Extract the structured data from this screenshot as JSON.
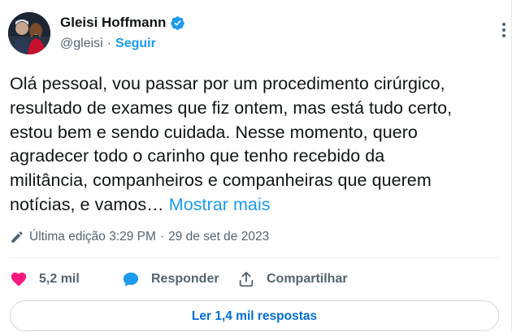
{
  "tweet": {
    "author": {
      "display_name": "Gleisi Hoffmann",
      "handle": "@gleisi",
      "separator": "·",
      "follow_label": "Seguir",
      "verified": true
    },
    "text_lines": [
      "Olá pessoal, vou passar por um procedimento cirúrgico,",
      "resultado de exames que fiz ontem, mas está tudo certo,",
      "estou bem e sendo cuidada. Nesse momento, quero",
      "agradecer todo o carinho que tenho recebido da",
      "militância, companheiros e companheiras que querem",
      "notícias, e vamos…"
    ],
    "show_more_label": "Mostrar mais",
    "edit_info": {
      "label": "Última edição 3:29 PM",
      "separator": "·",
      "date": "29 de set de 2023"
    },
    "actions": {
      "like_count": "5,2 mil",
      "reply_label": "Responder",
      "share_label": "Compartilhar"
    },
    "read_replies_label": "Ler 1,4 mil respostas"
  },
  "colors": {
    "accent": "#1d9bf0",
    "like": "#f91880",
    "secondary_text": "#536471",
    "link_button_text": "#006fd6"
  },
  "icons": {
    "verified": "verified-badge-icon",
    "more": "more-options-icon",
    "edit": "pencil-icon",
    "like": "heart-icon",
    "reply": "speech-bubble-icon",
    "share": "share-upload-icon"
  }
}
